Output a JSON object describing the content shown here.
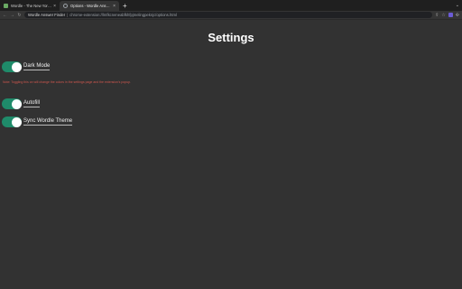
{
  "browser": {
    "tabs": [
      {
        "title": "Wordle - The New York Times",
        "active": false,
        "favicon": "wordle-favicon"
      },
      {
        "title": "Options - Wordle Answer Findr...",
        "active": true,
        "favicon": "extension-favicon"
      }
    ],
    "new_tab_glyph": "+",
    "close_glyph": "×",
    "tab_search_glyph": "⌄",
    "back_glyph": "←",
    "forward_glyph": "→",
    "reload_glyph": "↻",
    "origin": "Wordle Answer Finder",
    "url_separator": "|",
    "url": "chrome-extension://lmfkcneneabfkhfpjmelingpeknjc/options.html"
  },
  "page": {
    "title": "Settings",
    "settings": [
      {
        "label": "Dark Mode",
        "enabled": true
      },
      {
        "label": "Autofill",
        "enabled": true
      },
      {
        "label": "Sync Wordle Theme",
        "enabled": true
      }
    ],
    "note": "Note: Toggling this on will change the colors in the settings page and the extension's popup."
  },
  "colors": {
    "toggle_on": "#1f8b6a",
    "note": "#d0574e",
    "background": "#323232"
  }
}
